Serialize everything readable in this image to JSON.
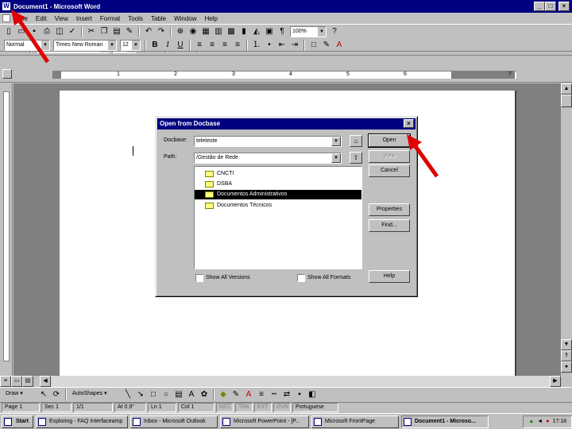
{
  "window": {
    "title": "Document1 - Microsoft Word",
    "buttons": [
      "_",
      "□",
      "×"
    ]
  },
  "menu": [
    "File",
    "Edit",
    "View",
    "Insert",
    "Format",
    "Tools",
    "Table",
    "Window",
    "Help"
  ],
  "toolbar": {
    "zoom": "100%"
  },
  "format": {
    "style": "Normal",
    "font": "Times New Roman",
    "size": "12"
  },
  "ruler": {
    "numbers": [
      "1",
      "2",
      "3",
      "4",
      "5",
      "6",
      "7"
    ]
  },
  "drawing": {
    "draw_label": "Draw",
    "autoshapes_label": "AutoShapes"
  },
  "status": {
    "page": "Page 1",
    "sec": "Sec 1",
    "pages": "1/1",
    "at": "At 0.9\"",
    "ln": "Ln 1",
    "col": "Col 1",
    "rec": "REC",
    "trk": "TRK",
    "ext": "EXT",
    "ovr": "OVR",
    "lang": "Portuguese"
  },
  "taskbar": {
    "start": "Start",
    "tasks": [
      "Exploring - FAQ Interfaceamp",
      "Inbox - Microsoft Outlook",
      "Microsoft PowerPoint - [P...",
      "Microsoft FrontPage",
      "Document1 - Microso..."
    ],
    "clock": "17:18"
  },
  "dialog": {
    "title": "Open from Docbase",
    "docbase_label": "Docbase:",
    "docbase_value": "teleteste",
    "path_label": "Path:",
    "path_value": "/Gestão de Rede",
    "folders": [
      "CNCTI",
      "DSBA",
      "Documentos Administrativos",
      "Documentos Técnicos"
    ],
    "selected_index": 2,
    "buttons": {
      "open": "Open",
      "view": "View",
      "cancel": "Cancel",
      "properties": "Properties",
      "find": "Find...",
      "help": "Help"
    },
    "show_all_versions": "Show All Versions",
    "show_all_formats": "Show All Formats"
  },
  "colors": {
    "titlebar": "#000080",
    "face": "#c0c0c0",
    "arrow": "#e00000"
  }
}
